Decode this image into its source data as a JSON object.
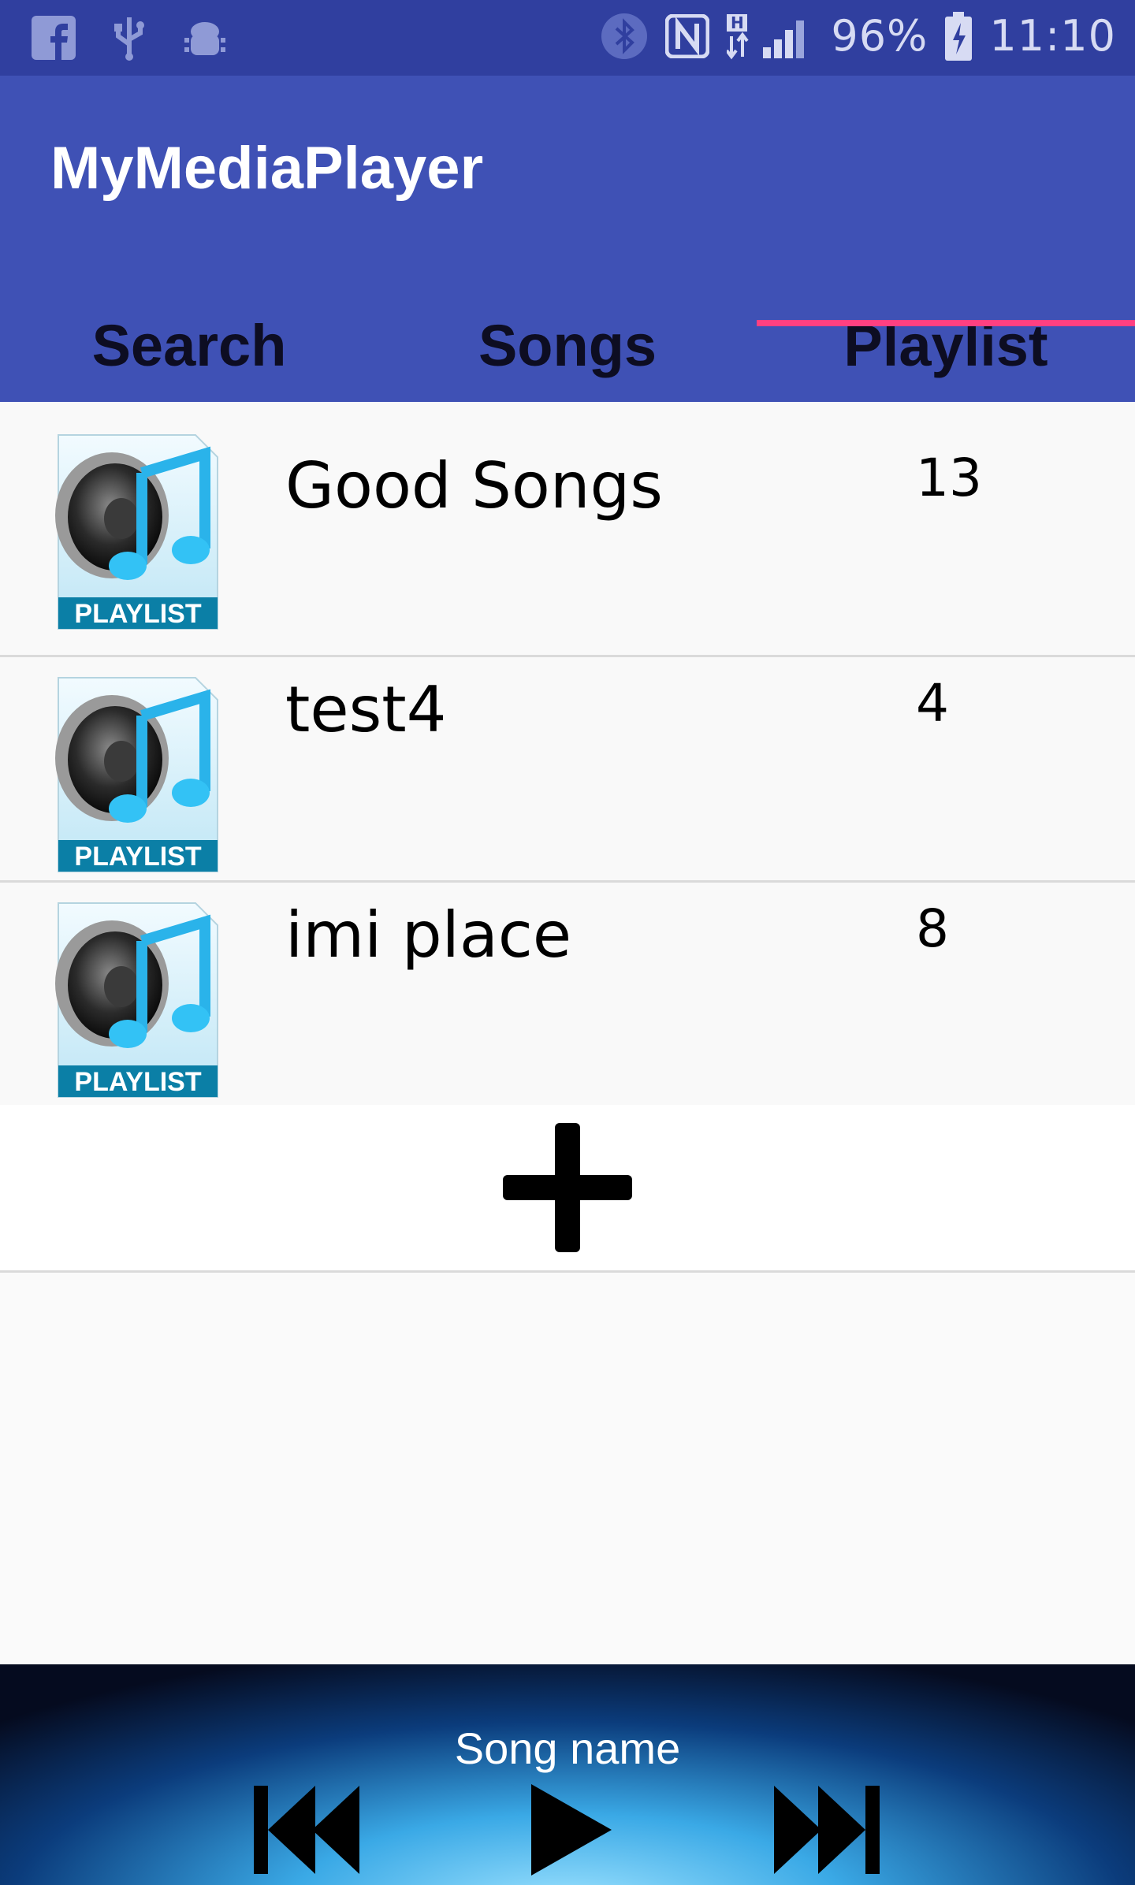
{
  "status_bar": {
    "battery": "96%",
    "time": "11:10",
    "icons": [
      "facebook-icon",
      "usb-icon",
      "android-debug-icon",
      "bluetooth-icon",
      "nfc-icon",
      "signal-icon",
      "battery-icon"
    ]
  },
  "app": {
    "title": "MyMediaPlayer"
  },
  "tabs": [
    {
      "label": "Search"
    },
    {
      "label": "Songs"
    },
    {
      "label": "Playlist",
      "selected": true
    }
  ],
  "playlists": [
    {
      "name": "Good Songs",
      "count": "13",
      "badge": "PLAYLIST"
    },
    {
      "name": "test4",
      "count": "4",
      "badge": "PLAYLIST"
    },
    {
      "name": "imi place",
      "count": "8",
      "badge": "PLAYLIST"
    }
  ],
  "player": {
    "song_name": "Song name"
  },
  "colors": {
    "status_bar": "#303f9f",
    "app_bar": "#3f51b5",
    "tab_indicator": "#ff4081",
    "background": "#fafafa"
  }
}
